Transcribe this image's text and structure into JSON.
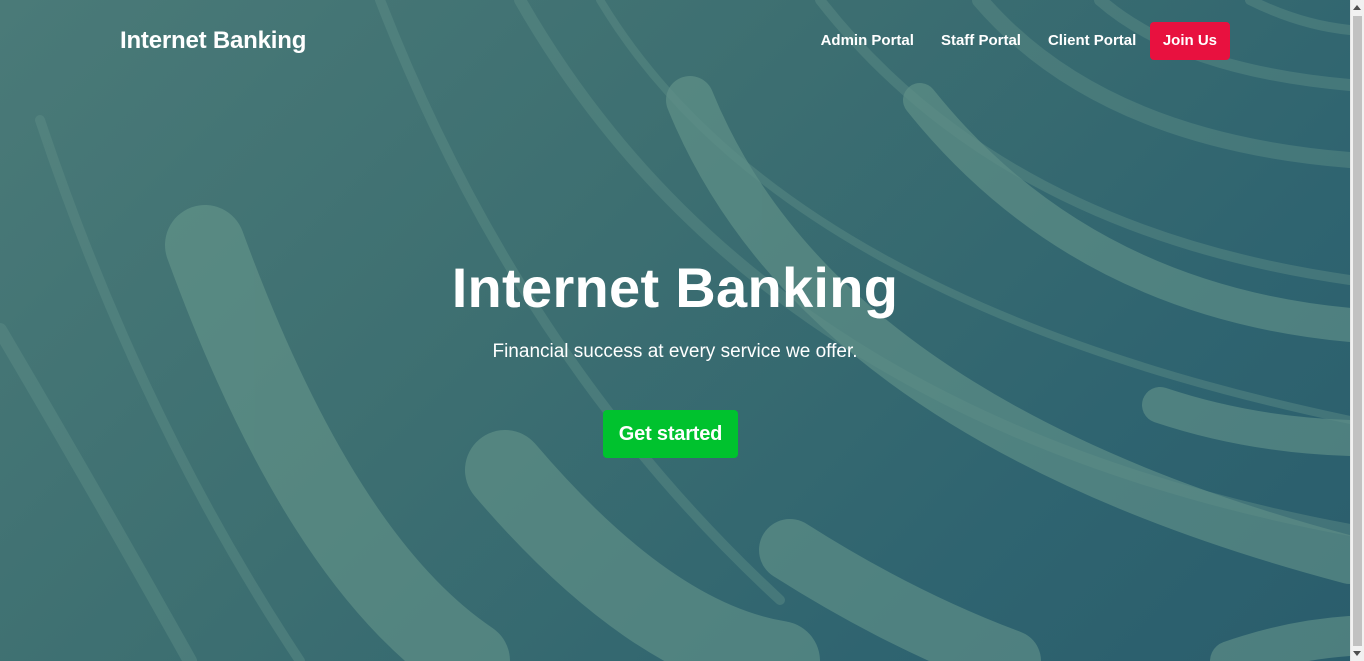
{
  "brand": {
    "name": "Internet Banking"
  },
  "nav": {
    "links": [
      {
        "label": "Admin Portal"
      },
      {
        "label": "Staff Portal"
      },
      {
        "label": "Client Portal"
      }
    ],
    "join_label": "Join Us"
  },
  "hero": {
    "title": "Internet Banking",
    "subtitle": "Financial success at every service we offer.",
    "cta_label": "Get started"
  },
  "colors": {
    "background": "#3d6f71",
    "join_button": "#e8113f",
    "cta_button": "#00c22e",
    "text": "#ffffff"
  },
  "icons": {
    "scroll_up": "scroll-up-arrow-icon",
    "scroll_down": "scroll-down-arrow-icon"
  }
}
